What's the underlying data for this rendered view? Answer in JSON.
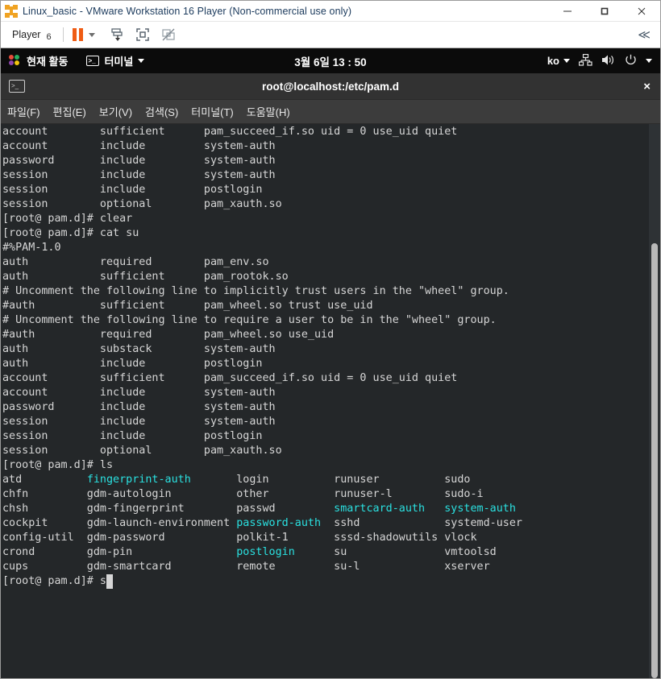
{
  "vmware": {
    "title": "Linux_basic - VMware Workstation 16 Player (Non-commercial use only)",
    "icon": "vmware-logo-icon",
    "window_buttons": [
      {
        "name": "minimize-button",
        "label": "–"
      },
      {
        "name": "maximize-button",
        "label": "□"
      },
      {
        "name": "close-button",
        "label": "×"
      }
    ],
    "toolbar": {
      "player_menu_label": "Player",
      "player_menu_badge": "6",
      "pause_icon": "pause-icon",
      "pause_dropdown_icon": "chevron-down-icon",
      "send_ctrl_alt_del_icon": "send-keys-icon",
      "fullscreen_icon": "fullscreen-icon",
      "unity_icon": "unity-mode-disabled-icon",
      "collapse_label": "≪"
    }
  },
  "gnome": {
    "activities_label": "현재 활동",
    "app_menu_label": "터미널",
    "app_menu_caret": "chevron-down-icon",
    "clock": "3월 6일  13 : 50",
    "input_source": "ko",
    "network_icon": "network-wired-icon",
    "volume_icon": "volume-icon",
    "power_icon": "power-icon",
    "system_menu_caret": "chevron-down-icon"
  },
  "terminal": {
    "window_title": "root@localhost:/etc/pam.d",
    "window_icon": "terminal-icon",
    "close_label": "×",
    "menu": [
      "파일(F)",
      "편집(E)",
      "보기(V)",
      "검색(S)",
      "터미널(T)",
      "도움말(H)"
    ],
    "colors": {
      "background": "#242729",
      "foreground": "#d6d6d6",
      "cyan": "#2ae0e0"
    },
    "scroll": {
      "thumb_top_pct": 21.5,
      "thumb_height_pct": 78.5
    },
    "lines": [
      {
        "segments": [
          {
            "t": "account        sufficient      pam_succeed_if.so uid = 0 use_uid quiet"
          }
        ]
      },
      {
        "segments": [
          {
            "t": "account        include         system-auth"
          }
        ]
      },
      {
        "segments": [
          {
            "t": "password       include         system-auth"
          }
        ]
      },
      {
        "segments": [
          {
            "t": "session        include         system-auth"
          }
        ]
      },
      {
        "segments": [
          {
            "t": "session        include         postlogin"
          }
        ]
      },
      {
        "segments": [
          {
            "t": "session        optional        pam_xauth.so"
          }
        ]
      },
      {
        "segments": [
          {
            "t": "[root@ pam.d]# clear"
          }
        ]
      },
      {
        "segments": [
          {
            "t": ""
          }
        ]
      },
      {
        "segments": [
          {
            "t": ""
          }
        ]
      },
      {
        "segments": [
          {
            "t": ""
          }
        ]
      },
      {
        "segments": [
          {
            "t": ""
          }
        ]
      },
      {
        "segments": [
          {
            "t": ""
          }
        ]
      },
      {
        "segments": [
          {
            "t": ""
          }
        ]
      },
      {
        "segments": [
          {
            "t": "[root@ pam.d]# cat su"
          }
        ]
      },
      {
        "segments": [
          {
            "t": "#%PAM-1.0"
          }
        ]
      },
      {
        "segments": [
          {
            "t": "auth           required        pam_env.so"
          }
        ]
      },
      {
        "segments": [
          {
            "t": "auth           sufficient      pam_rootok.so"
          }
        ]
      },
      {
        "segments": [
          {
            "t": "# Uncomment the following line to implicitly trust users in the \"wheel\" group."
          }
        ]
      },
      {
        "segments": [
          {
            "t": "#auth          sufficient      pam_wheel.so trust use_uid"
          }
        ]
      },
      {
        "segments": [
          {
            "t": "# Uncomment the following line to require a user to be in the \"wheel\" group."
          }
        ]
      },
      {
        "segments": [
          {
            "t": "#auth          required        pam_wheel.so use_uid"
          }
        ]
      },
      {
        "segments": [
          {
            "t": "auth           substack        system-auth"
          }
        ]
      },
      {
        "segments": [
          {
            "t": "auth           include         postlogin"
          }
        ]
      },
      {
        "segments": [
          {
            "t": "account        sufficient      pam_succeed_if.so uid = 0 use_uid quiet"
          }
        ]
      },
      {
        "segments": [
          {
            "t": "account        include         system-auth"
          }
        ]
      },
      {
        "segments": [
          {
            "t": "password       include         system-auth"
          }
        ]
      },
      {
        "segments": [
          {
            "t": "session        include         system-auth"
          }
        ]
      },
      {
        "segments": [
          {
            "t": "session        include         postlogin"
          }
        ]
      },
      {
        "segments": [
          {
            "t": "session        optional        pam_xauth.so"
          }
        ]
      },
      {
        "segments": [
          {
            "t": "[root@ pam.d]# ls"
          }
        ]
      },
      {
        "segments": [
          {
            "t": "atd          "
          },
          {
            "t": "fingerprint-auth",
            "c": "cy"
          },
          {
            "t": "       login          runuser          sudo"
          }
        ]
      },
      {
        "segments": [
          {
            "t": "chfn         gdm-autologin          other          runuser-l        sudo-i"
          }
        ]
      },
      {
        "segments": [
          {
            "t": "chsh         gdm-fingerprint        passwd         "
          },
          {
            "t": "smartcard-auth",
            "c": "cy"
          },
          {
            "t": "   "
          },
          {
            "t": "system-auth",
            "c": "cy"
          }
        ]
      },
      {
        "segments": [
          {
            "t": "cockpit      gdm-launch-environment "
          },
          {
            "t": "password-auth",
            "c": "cy"
          },
          {
            "t": "  sshd             systemd-user"
          }
        ]
      },
      {
        "segments": [
          {
            "t": "config-util  gdm-password           polkit-1       sssd-shadowutils vlock"
          }
        ]
      },
      {
        "segments": [
          {
            "t": "crond        gdm-pin                "
          },
          {
            "t": "postlogin",
            "c": "cy"
          },
          {
            "t": "      su               vmtoolsd"
          }
        ]
      },
      {
        "segments": [
          {
            "t": "cups         gdm-smartcard          remote         su-l             xserver"
          }
        ]
      },
      {
        "segments": [
          {
            "t": "[root@ pam.d]# s"
          },
          {
            "t": " ",
            "cursor": true
          }
        ]
      }
    ]
  }
}
